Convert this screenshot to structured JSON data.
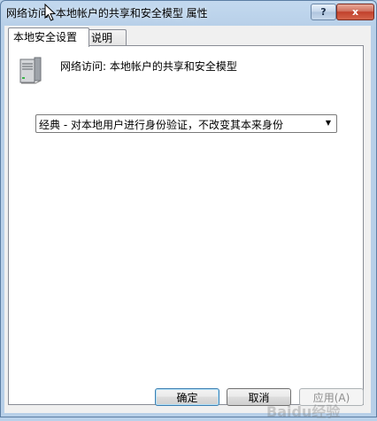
{
  "window": {
    "title": "网络访问: 本地帐户的共享和安全模型 属性",
    "help_label": "?",
    "close_label": "x"
  },
  "tabs": [
    {
      "label": "本地安全设置",
      "active": true
    },
    {
      "label": "说明",
      "active": false
    }
  ],
  "policy": {
    "name": "网络访问: 本地帐户的共享和安全模型",
    "icon": "server-icon"
  },
  "setting": {
    "selected": "经典 - 对本地用户进行身份验证，不改变其本来身份"
  },
  "buttons": {
    "ok": "确定",
    "cancel": "取消",
    "apply": "应用(A)"
  },
  "watermark": "Baidu经验"
}
